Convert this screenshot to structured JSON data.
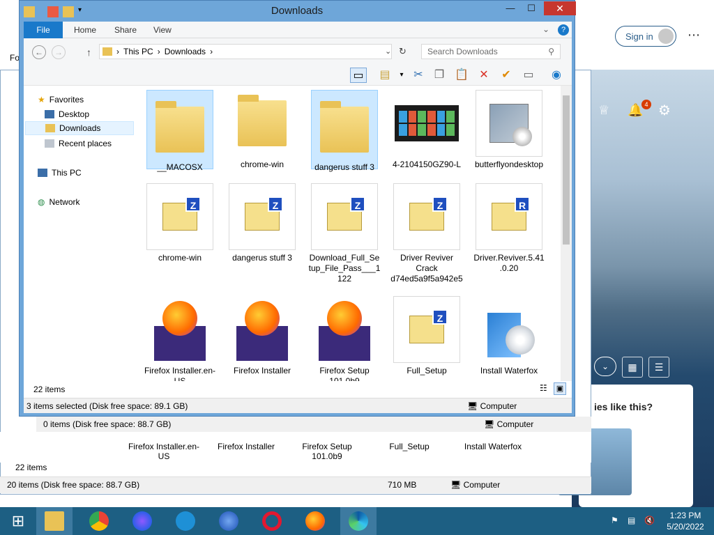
{
  "window": {
    "title": "Downloads",
    "minimize": "—",
    "maximize": "☐",
    "close": "✕"
  },
  "ribbon": {
    "tabs": [
      "File",
      "Home",
      "Share",
      "View"
    ]
  },
  "address": {
    "crumbs": [
      "This PC",
      "Downloads"
    ],
    "search_placeholder": "Search Downloads"
  },
  "nav_pane": {
    "favorites": "Favorites",
    "desktop": "Desktop",
    "downloads": "Downloads",
    "recent": "Recent places",
    "this_pc": "This PC",
    "network": "Network"
  },
  "files": [
    {
      "name": "__MACOSX",
      "type": "folder",
      "selected": true
    },
    {
      "name": "chrome-win",
      "type": "folder",
      "selected": false
    },
    {
      "name": "dangerus stuff 3",
      "type": "folder",
      "selected": true
    },
    {
      "name": "4-2104150GZ90-L",
      "type": "image",
      "selected": false
    },
    {
      "name": "butterflyondesktop",
      "type": "setup",
      "selected": false
    },
    {
      "name": "chrome-win",
      "type": "zip",
      "selected": false
    },
    {
      "name": "dangerus stuff 3",
      "type": "zip",
      "selected": false
    },
    {
      "name": "Download_Full_Setup_File_Pass___1122",
      "type": "zip",
      "selected": false
    },
    {
      "name": "Driver Reviver Crack d74ed5a9f5a942e5",
      "type": "zip",
      "selected": false
    },
    {
      "name": "Driver.Reviver.5.41.0.20",
      "type": "rar",
      "selected": false
    },
    {
      "name": "Firefox Installer.en-US",
      "type": "firefox",
      "selected": false
    },
    {
      "name": "Firefox Installer",
      "type": "firefox",
      "selected": false
    },
    {
      "name": "Firefox Setup 101.0b9",
      "type": "firefox",
      "selected": false
    },
    {
      "name": "Full_Setup",
      "type": "zip",
      "selected": false
    },
    {
      "name": "Install Waterfox",
      "type": "waterfox",
      "selected": false
    }
  ],
  "status": {
    "items_count": "22 items",
    "selected": "3 items selected (Disk free space: 89.1 GB)",
    "computer": "Computer"
  },
  "behind_window": {
    "status_line": "0 items (Disk free space: 88.7 GB)",
    "computer": "Computer",
    "items_count": "22 items",
    "bottom_status": "20 items (Disk free space: 88.7 GB)",
    "size": "710 MB",
    "computer2": "Computer",
    "labels": [
      "Firefox Installer.en-US",
      "Firefox Installer",
      "Firefox Setup 101.0b9",
      "Full_Setup",
      "Install Waterfox"
    ]
  },
  "browser": {
    "sign_in": "Sign in",
    "notif_count": "4",
    "card_text": "ies like this?",
    "left_label": "Fo"
  },
  "taskbar": {
    "time": "1:23 PM",
    "date": "5/20/2022"
  }
}
